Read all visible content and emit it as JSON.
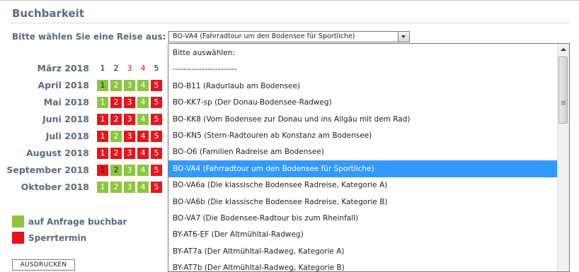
{
  "page": {
    "heading": "Buchbarkeit"
  },
  "selector": {
    "prompt": "Bitte wählen Sie eine Reise aus:",
    "value": "BO-VA4 (Fahrradtour um den Bodensee für Sportliche)"
  },
  "calendar": {
    "months": [
      {
        "label": "März 2018",
        "cells": [
          {
            "n": "1",
            "s": "plain"
          },
          {
            "n": "2",
            "s": "plain"
          },
          {
            "n": "3",
            "s": "plain-red"
          },
          {
            "n": "4",
            "s": "plain-red"
          },
          {
            "n": "5",
            "s": "plain"
          }
        ]
      },
      {
        "label": "April 2018",
        "cells": [
          {
            "n": "1",
            "s": "green-dark"
          },
          {
            "n": "2",
            "s": "green"
          },
          {
            "n": "3",
            "s": "green"
          },
          {
            "n": "4",
            "s": "green"
          },
          {
            "n": "5",
            "s": "red"
          }
        ]
      },
      {
        "label": "Mai 2018",
        "cells": [
          {
            "n": "1",
            "s": "green"
          },
          {
            "n": "2",
            "s": "red"
          },
          {
            "n": "3",
            "s": "red"
          },
          {
            "n": "4",
            "s": "green"
          },
          {
            "n": "5",
            "s": "red"
          }
        ]
      },
      {
        "label": "Juni 2018",
        "cells": [
          {
            "n": "1",
            "s": "red"
          },
          {
            "n": "2",
            "s": "red"
          },
          {
            "n": "3",
            "s": "red"
          },
          {
            "n": "4",
            "s": "green"
          },
          {
            "n": "5",
            "s": "red"
          }
        ]
      },
      {
        "label": "Juli 2018",
        "cells": [
          {
            "n": "1",
            "s": "red"
          },
          {
            "n": "2",
            "s": "green"
          },
          {
            "n": "3",
            "s": "red"
          },
          {
            "n": "4",
            "s": "red"
          },
          {
            "n": "5",
            "s": "red"
          }
        ]
      },
      {
        "label": "August 2018",
        "cells": [
          {
            "n": "1",
            "s": "red"
          },
          {
            "n": "2",
            "s": "red"
          },
          {
            "n": "3",
            "s": "red"
          },
          {
            "n": "4",
            "s": "red"
          },
          {
            "n": "5",
            "s": "red"
          }
        ]
      },
      {
        "label": "September 2018",
        "cells": [
          {
            "n": "1",
            "s": "red-dark"
          },
          {
            "n": "2",
            "s": "green-dark"
          },
          {
            "n": "3",
            "s": "green"
          },
          {
            "n": "4",
            "s": "green"
          },
          {
            "n": "5",
            "s": "red"
          }
        ]
      },
      {
        "label": "Oktober 2018",
        "cells": [
          {
            "n": "1",
            "s": "green"
          },
          {
            "n": "2",
            "s": "green"
          },
          {
            "n": "3",
            "s": "green"
          },
          {
            "n": "4",
            "s": "green"
          },
          {
            "n": "5",
            "s": "red"
          }
        ]
      }
    ]
  },
  "legend": [
    {
      "label": "auf Anfrage buchbar",
      "color": "#8cc63f"
    },
    {
      "label": "Sperrtermin",
      "color": "#e8141c"
    }
  ],
  "print_button": {
    "label": "AUSDRUCKEN"
  },
  "dropdown": {
    "options": [
      "Bitte auswählen:",
      "------------------------",
      "BO-B11 (Radurlaub am Bodensee)",
      "BO-KK7-sp (Der Donau-Bodensee-Radweg)",
      "BO-KK8 (Vom Bodensee zur Donau und ins Allgäu mit dem Rad)",
      "BO-KN5 (Stern-Radtouren ab Konstanz am Bodensee)",
      "BO-O6 (Familien Radreise am Bodensee)",
      "BO-VA4 (Fahrradtour um den Bodensee für Sportliche)",
      "BO-VA6a (Die klassische Bodensee Radreise, Kategorie A)",
      "BO-VA6b (Die klassische Bodensee Radreise, Kategorie B)",
      "BO-VA7 (Die Bodensee-Radtour bis zum Rheinfall)",
      "BY-AT6-EF (Der Altmühltal-Radweg)",
      "BY-AT7a (Der Altmühltal-Radweg, Kategorie A)",
      "BY-AT7b (Der Altmühltal-Radweg, Kategorie B)"
    ],
    "selected_index": 7
  },
  "colors": {
    "accent": "#3399ff",
    "label_text": "#5a6a82",
    "available": "#8cc63f",
    "blocked": "#e8141c"
  }
}
